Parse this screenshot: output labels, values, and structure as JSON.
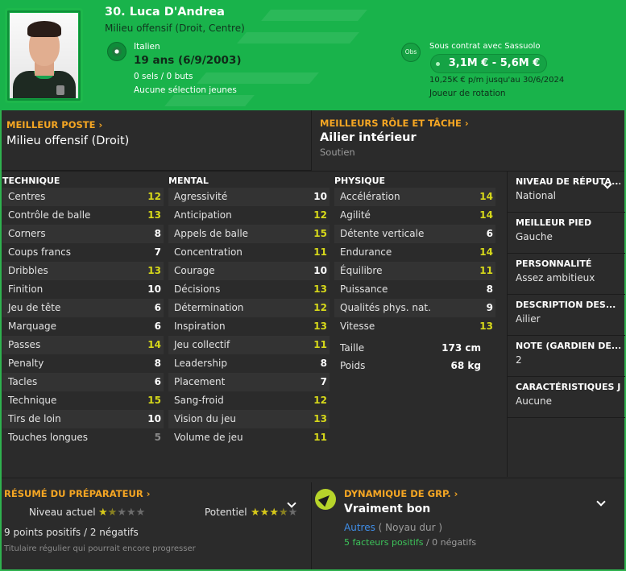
{
  "header": {
    "name": "30. Luca D'Andrea",
    "role": "Milieu offensif (Droit, Centre)",
    "nationality": "Italien",
    "age": "19 ans (6/9/2003)",
    "caps": "0 sels / 0 buts",
    "youth_caps": "Aucune sélection jeunes",
    "obs_label": "Obs",
    "contract": "Sous contrat avec Sassuolo",
    "value": "3,1M € - 5,6M €",
    "wage": "10,25K € p/m jusqu'au 30/6/2024",
    "squad_status": "Joueur de rotation"
  },
  "best_position": {
    "title": "MEILLEUR POSTE ›",
    "value": "Milieu offensif (Droit)"
  },
  "best_role": {
    "title": "MEILLEURS RÔLE ET TÂCHE ›",
    "value": "Ailier intérieur",
    "duty": "Soutien"
  },
  "technique": {
    "title": "TECHNIQUE",
    "rows": [
      {
        "name": "Centres",
        "value": "12",
        "tone": "yellow"
      },
      {
        "name": "Contrôle de balle",
        "value": "13",
        "tone": "yellow"
      },
      {
        "name": "Corners",
        "value": "8",
        "tone": "white"
      },
      {
        "name": "Coups francs",
        "value": "7",
        "tone": "white"
      },
      {
        "name": "Dribbles",
        "value": "13",
        "tone": "yellow"
      },
      {
        "name": "Finition",
        "value": "10",
        "tone": "white"
      },
      {
        "name": "Jeu de tête",
        "value": "6",
        "tone": "white"
      },
      {
        "name": "Marquage",
        "value": "6",
        "tone": "white"
      },
      {
        "name": "Passes",
        "value": "14",
        "tone": "yellow"
      },
      {
        "name": "Penalty",
        "value": "8",
        "tone": "white"
      },
      {
        "name": "Tacles",
        "value": "6",
        "tone": "white"
      },
      {
        "name": "Technique",
        "value": "15",
        "tone": "yellow"
      },
      {
        "name": "Tirs de loin",
        "value": "10",
        "tone": "white"
      },
      {
        "name": "Touches longues",
        "value": "5",
        "tone": "grey"
      }
    ]
  },
  "mental": {
    "title": "MENTAL",
    "rows": [
      {
        "name": "Agressivité",
        "value": "10",
        "tone": "white"
      },
      {
        "name": "Anticipation",
        "value": "12",
        "tone": "yellow"
      },
      {
        "name": "Appels de balle",
        "value": "15",
        "tone": "yellow"
      },
      {
        "name": "Concentration",
        "value": "11",
        "tone": "yellow"
      },
      {
        "name": "Courage",
        "value": "10",
        "tone": "white"
      },
      {
        "name": "Décisions",
        "value": "13",
        "tone": "yellow"
      },
      {
        "name": "Détermination",
        "value": "12",
        "tone": "yellow"
      },
      {
        "name": "Inspiration",
        "value": "13",
        "tone": "yellow"
      },
      {
        "name": "Jeu collectif",
        "value": "11",
        "tone": "yellow"
      },
      {
        "name": "Leadership",
        "value": "8",
        "tone": "white"
      },
      {
        "name": "Placement",
        "value": "7",
        "tone": "white"
      },
      {
        "name": "Sang-froid",
        "value": "12",
        "tone": "yellow"
      },
      {
        "name": "Vision du jeu",
        "value": "13",
        "tone": "yellow"
      },
      {
        "name": "Volume de jeu",
        "value": "11",
        "tone": "yellow"
      }
    ]
  },
  "physique": {
    "title": "PHYSIQUE",
    "rows": [
      {
        "name": "Accélération",
        "value": "14",
        "tone": "yellow"
      },
      {
        "name": "Agilité",
        "value": "14",
        "tone": "yellow"
      },
      {
        "name": "Détente verticale",
        "value": "6",
        "tone": "white"
      },
      {
        "name": "Endurance",
        "value": "14",
        "tone": "yellow"
      },
      {
        "name": "Équilibre",
        "value": "11",
        "tone": "yellow"
      },
      {
        "name": "Puissance",
        "value": "8",
        "tone": "white"
      },
      {
        "name": "Qualités phys. nat.",
        "value": "9",
        "tone": "white"
      },
      {
        "name": "Vitesse",
        "value": "13",
        "tone": "yellow"
      }
    ],
    "extra": [
      {
        "name": "Taille",
        "value": "173 cm"
      },
      {
        "name": "Poids",
        "value": "68 kg"
      }
    ]
  },
  "info": [
    {
      "label": "NIVEAU DE RÉPUTA...",
      "text": "National"
    },
    {
      "label": "MEILLEUR PIED",
      "text": "Gauche"
    },
    {
      "label": "PERSONNALITÉ",
      "text": "Assez ambitieux"
    },
    {
      "label": "DESCRIPTION DES...",
      "text": "Ailier"
    },
    {
      "label": "NOTE (GARDIEN DE...",
      "text": "2"
    },
    {
      "label": "CARACTÉRISTIQUES J",
      "text": "Aucune"
    }
  ],
  "coach": {
    "title": "RÉSUMÉ DU PRÉPARATEUR ›",
    "current_label": "Niveau actuel",
    "potential_label": "Potentiel",
    "current_stars": 1.5,
    "potential_stars": 3.5,
    "points": "9 points positifs / 2 négatifs",
    "remark": "Titulaire régulier qui pourrait encore progresser"
  },
  "dynamics": {
    "title": "DYNAMIQUE DE GRP. ›",
    "value": "Vraiment bon",
    "group": "Autres",
    "group_desc": "( Noyau dur )",
    "positives": "5 facteurs positifs",
    "sep": "/",
    "negatives": "0 négatifs"
  },
  "colors": {
    "header_green": "#19b34b",
    "accent_orange": "#f5a623",
    "high_value": "#d6d81a"
  }
}
